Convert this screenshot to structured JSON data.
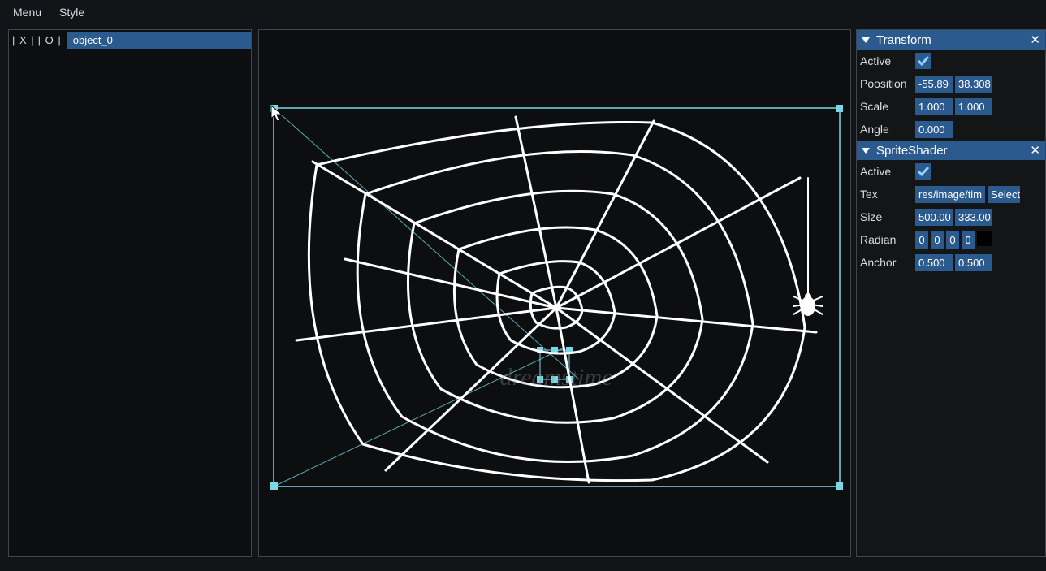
{
  "menu": {
    "menu": "Menu",
    "style": "Style"
  },
  "hierarchy": {
    "prefixX": "| X |",
    "prefixO": "| O |",
    "object": "object_0"
  },
  "inspector": {
    "transform": {
      "title": "Transform",
      "close": "✕",
      "active_lbl": "Active",
      "position_lbl": "Poosition",
      "position_x": "-55.89",
      "position_y": "38.308",
      "scale_lbl": "Scale",
      "scale_x": "1.000",
      "scale_y": "1.000",
      "angle_lbl": "Angle",
      "angle": "0.000"
    },
    "sprite": {
      "title": "SpriteShader",
      "close": "✕",
      "active_lbl": "Active",
      "tex_lbl": "Tex",
      "tex_path": "res/image/tim",
      "tex_btn": "Select",
      "size_lbl": "Size",
      "size_x": "500.00",
      "size_y": "333.00",
      "radian_lbl": "Radian",
      "rad_0": "0",
      "rad_1": "0",
      "rad_2": "0",
      "rad_3": "0",
      "anchor_lbl": "Anchor",
      "anchor_x": "0.500",
      "anchor_y": "0.500"
    }
  },
  "viewport": {
    "watermark": "dreamstime"
  }
}
